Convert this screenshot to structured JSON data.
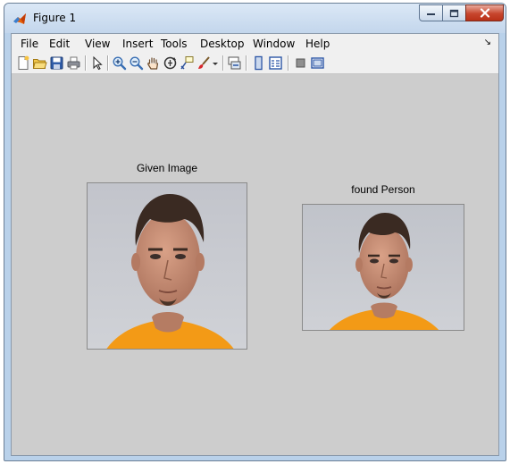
{
  "window": {
    "title": "Figure 1",
    "controls": {
      "minimize_icon": "minimize-icon",
      "maximize_icon": "maximize-icon",
      "close_icon": "close-icon"
    }
  },
  "menubar": {
    "items": [
      "File",
      "Edit",
      "View",
      "Insert",
      "Tools",
      "Desktop",
      "Window",
      "Help"
    ],
    "dock_arrow": "↘"
  },
  "toolbar": {
    "tools": [
      "new-figure-icon",
      "open-file-icon",
      "save-icon",
      "print-icon",
      "edit-plot-arrow-icon",
      "zoom-in-icon",
      "zoom-out-icon",
      "pan-hand-icon",
      "rotate-3d-icon",
      "data-cursor-icon",
      "brush-icon",
      "brush-dropdown-icon",
      "link-plot-icon",
      "insert-colorbar-icon",
      "insert-legend-icon",
      "hide-plot-tools-icon",
      "show-plot-tools-icon"
    ]
  },
  "figure": {
    "background": "#cdcdcd",
    "axes": [
      {
        "title": "Given Image"
      },
      {
        "title": "found Person"
      }
    ]
  },
  "colors": {
    "shirt": "#f39a16",
    "backdrop": "#c7c9cf",
    "skin": "#c58a6f",
    "hair": "#3a2a22"
  }
}
